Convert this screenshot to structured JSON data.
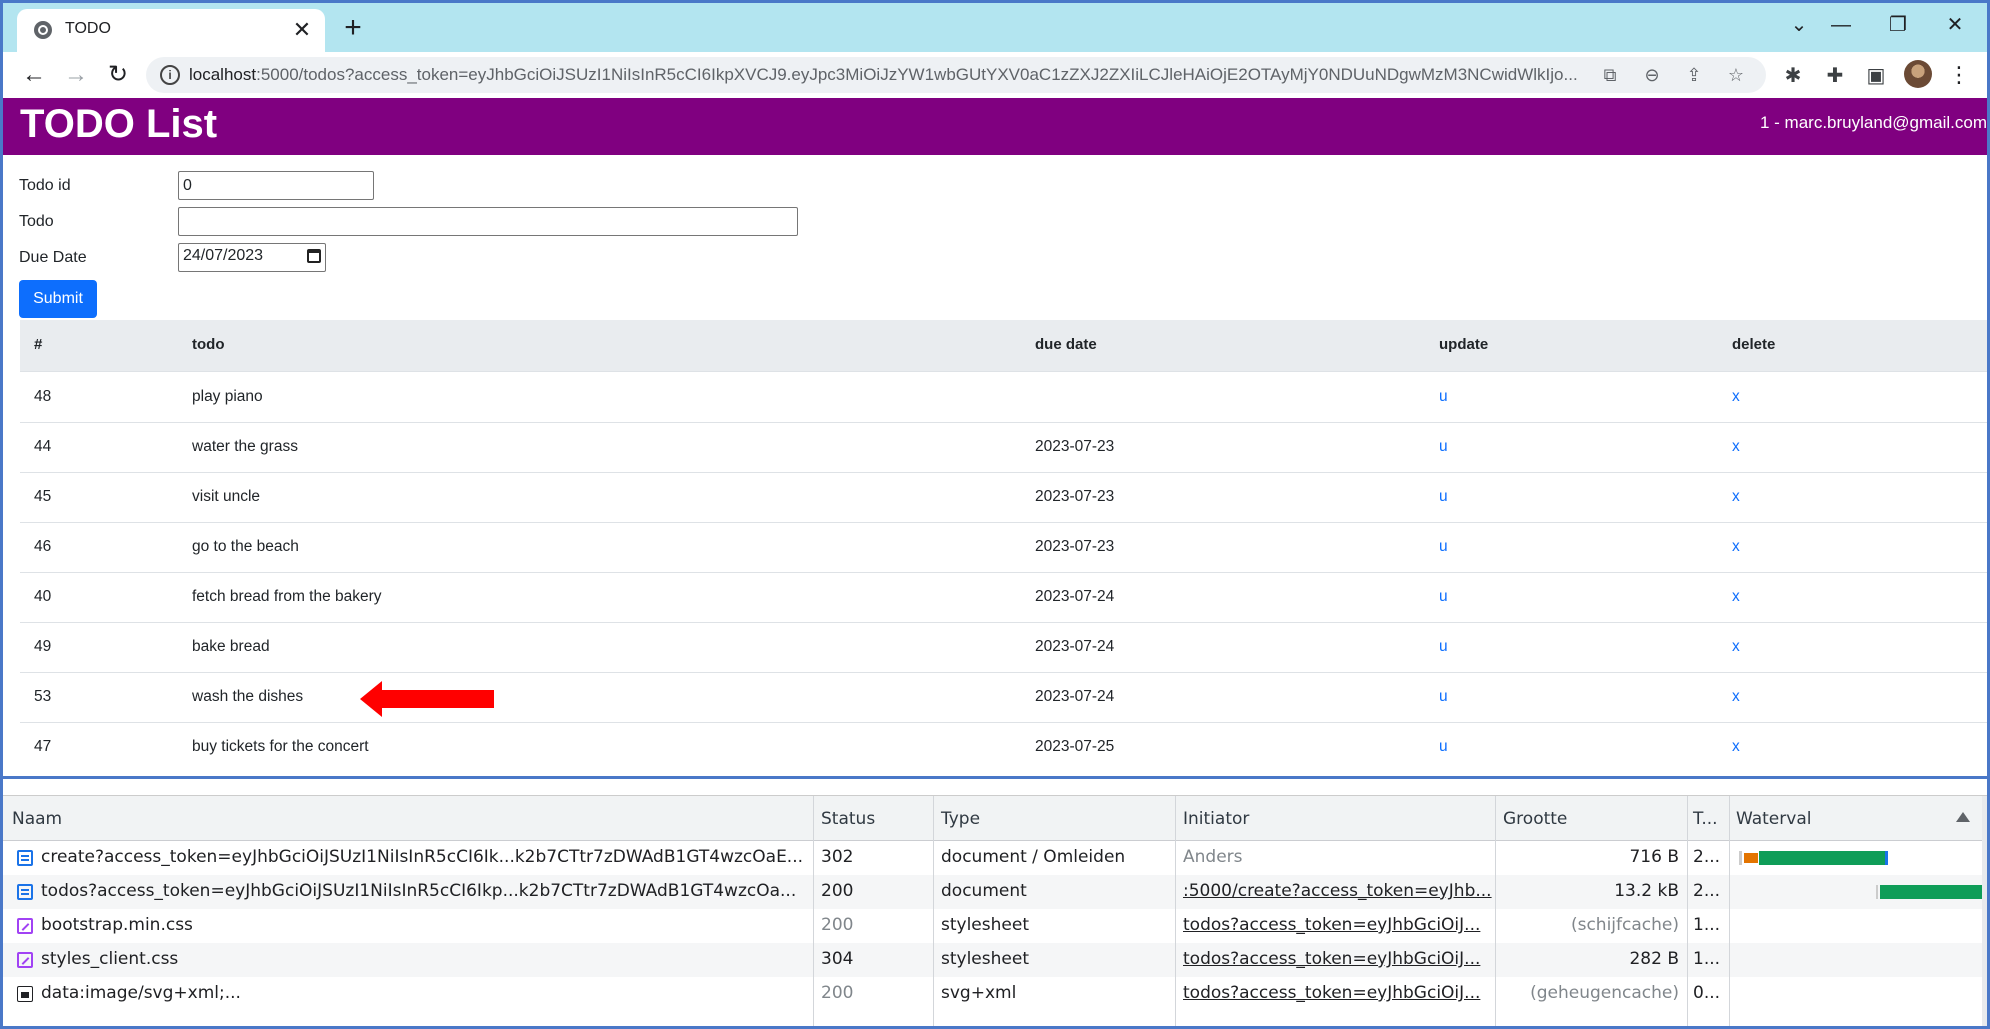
{
  "browser": {
    "tab_title": "TODO",
    "tab_close": "✕",
    "new_tab": "+",
    "window_controls": [
      "⌄",
      "—",
      "❐",
      "✕"
    ],
    "url_host": "localhost",
    "url_rest": ":5000/todos?access_token=eyJhbGciOiJSUzI1NiIsInR5cCI6IkpXVCJ9.eyJpc3MiOiJzYW1wbGUtYXV0aC1zZXJ2ZXIiLCJleHAiOjE2OTAyMjY0NDUuNDgwMzM3NCwidWlkIjo..."
  },
  "app": {
    "brand": "TODO List",
    "user": "1 - marc.bruyland@gmail.com",
    "form": {
      "todo_id_label": "Todo id",
      "todo_id_value": "0",
      "todo_label": "Todo",
      "todo_value": "",
      "due_date_label": "Due Date",
      "due_date_value": "24/07/2023",
      "submit_label": "Submit"
    },
    "table": {
      "headers": [
        "#",
        "todo",
        "due date",
        "update",
        "delete"
      ],
      "rows": [
        {
          "id": "48",
          "todo": "play piano",
          "due": "",
          "update": "u",
          "delete": "x"
        },
        {
          "id": "44",
          "todo": "water the grass",
          "due": "2023-07-23",
          "update": "u",
          "delete": "x"
        },
        {
          "id": "45",
          "todo": "visit uncle",
          "due": "2023-07-23",
          "update": "u",
          "delete": "x"
        },
        {
          "id": "46",
          "todo": "go to the beach",
          "due": "2023-07-23",
          "update": "u",
          "delete": "x"
        },
        {
          "id": "40",
          "todo": "fetch bread from the bakery",
          "due": "2023-07-24",
          "update": "u",
          "delete": "x"
        },
        {
          "id": "49",
          "todo": "bake bread",
          "due": "2023-07-24",
          "update": "u",
          "delete": "x"
        },
        {
          "id": "53",
          "todo": "wash the dishes",
          "due": "2023-07-24",
          "update": "u",
          "delete": "x"
        },
        {
          "id": "47",
          "todo": "buy tickets for the concert",
          "due": "2023-07-25",
          "update": "u",
          "delete": "x"
        }
      ]
    }
  },
  "devtools": {
    "headers": [
      "Naam",
      "Status",
      "Type",
      "Initiator",
      "Grootte",
      "T...",
      "Waterval"
    ],
    "rows": [
      {
        "icon": "doc",
        "name": "create?access_token=eyJhbGciOiJSUzI1NiIsInR5cCI6Ik...k2b7CTtr7zDWAdB1GT4wzcOaE...",
        "status": "302",
        "type": "document / Omleiden",
        "initiator": "Anders",
        "size": "716 B",
        "time": "2..."
      },
      {
        "icon": "doc",
        "name": "todos?access_token=eyJhbGciOiJSUzI1NiIsInR5cCI6Ikp...k2b7CTtr7zDWAdB1GT4wzcOa...",
        "status": "200",
        "type": "document",
        "initiator": ":5000/create?access_token=eyJhb...",
        "size": "13.2 kB",
        "time": "2..."
      },
      {
        "icon": "css",
        "name": "bootstrap.min.css",
        "status": "200",
        "type": "stylesheet",
        "initiator": "todos?access_token=eyJhbGciOiJ...",
        "size": "(schijfcache)",
        "time": "1..."
      },
      {
        "icon": "css",
        "name": "styles_client.css",
        "status": "304",
        "type": "stylesheet",
        "initiator": "todos?access_token=eyJhbGciOiJ...",
        "size": "282 B",
        "time": "1..."
      },
      {
        "icon": "svg",
        "name": "data:image/svg+xml;...",
        "status": "200",
        "type": "svg+xml",
        "initiator": "todos?access_token=eyJhbGciOiJ...",
        "size": "(geheugencache)",
        "time": "0..."
      }
    ]
  },
  "colors": {
    "navbar": "#800080",
    "tabstrip": "#b3e5f0",
    "primary": "#0d6efd",
    "arrow": "#ff0000",
    "waterfall_green": "#0f9d58",
    "waterfall_orange": "#e37400"
  },
  "icons": {
    "tab": "globe-icon",
    "nav": [
      "back-arrow-icon",
      "forward-arrow-icon",
      "reload-icon"
    ],
    "omnibox": [
      "info-icon",
      "translate-icon",
      "zoom-out-icon",
      "share-icon",
      "star-icon"
    ],
    "toolbar": [
      "bug-extension-icon",
      "puzzle-extensions-icon",
      "side-panel-icon",
      "profile-avatar",
      "more-menu-icon"
    ]
  }
}
